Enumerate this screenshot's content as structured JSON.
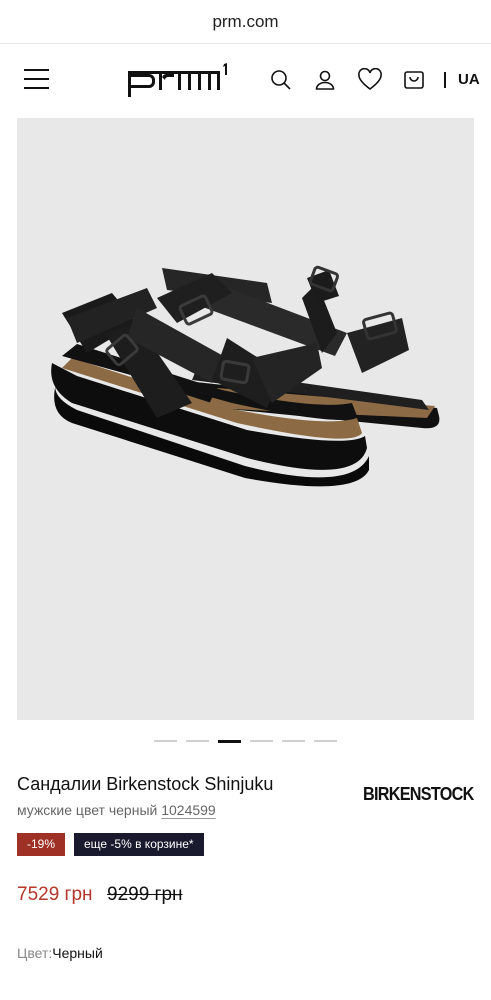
{
  "browser": {
    "url": "prm.com"
  },
  "header": {
    "logo_text": "prm",
    "logo_superscript": "1",
    "language": "UA"
  },
  "icons": {
    "menu": "hamburger-menu-icon",
    "search": "search-icon",
    "account": "user-icon",
    "wishlist": "heart-icon",
    "cart": "shopping-bag-icon"
  },
  "gallery": {
    "image_alt": "Birkenstock Shinjuku sandals",
    "dot_count": 6,
    "active_index": 2
  },
  "product": {
    "title": "Сандалии Birkenstock Shinjuku",
    "subtitle_prefix": "мужские цвет черный",
    "sku": "1024599",
    "brand": "BIRKENSTOCK",
    "discount_badge": "-19%",
    "cart_promo": "еще -5% в корзине*",
    "price": "7529 грн",
    "old_price": "9299 грн",
    "color_label": "Цвет:",
    "color_value": "Черный"
  },
  "colors": {
    "discount": "#9e3025",
    "promo_bg": "#1a1a2e",
    "price": "#b5362a"
  }
}
